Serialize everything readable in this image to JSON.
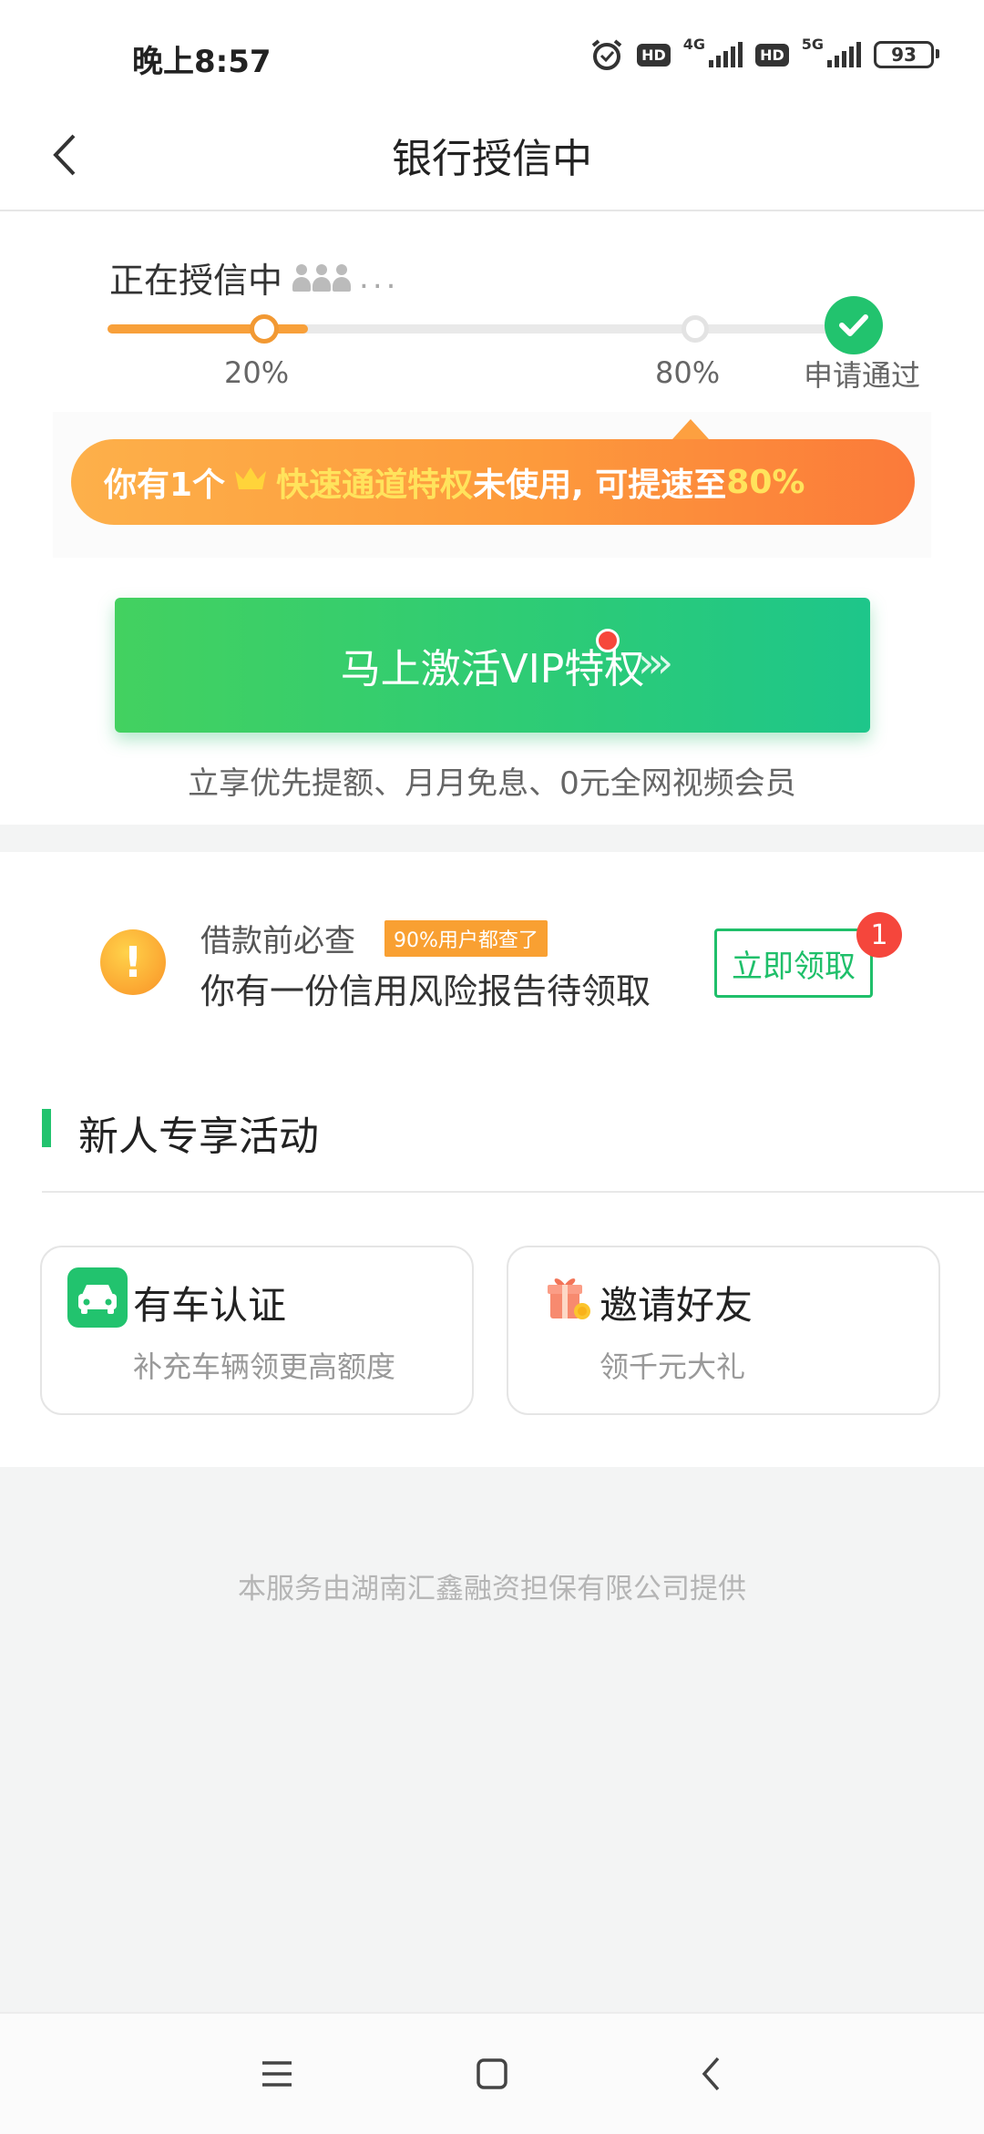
{
  "status_bar": {
    "time": "晚上8:57",
    "icons": [
      "alarm-icon",
      "hd-icon",
      "signal-4g-icon",
      "hd-icon",
      "signal-5g-icon",
      "battery-icon"
    ],
    "hd_label": "HD",
    "net1": "4G",
    "net2": "5G",
    "battery": "93"
  },
  "header": {
    "title": "银行授信中",
    "back_icon": "back-arrow-icon"
  },
  "progress": {
    "status_text": "正在授信中",
    "dots": "...",
    "current_percent": 20,
    "steps": [
      {
        "label": "20%"
      },
      {
        "label": "80%"
      },
      {
        "label": "申请通过"
      }
    ],
    "colors": {
      "fill": "#f8a03a",
      "done": "#22c36e",
      "track": "#e9e9e9"
    }
  },
  "promo": {
    "part1": "你有1个",
    "highlight": "快速通道特权",
    "part2": "未使用, 可提速至",
    "target": "80%",
    "crown_icon": "crown-icon"
  },
  "vip": {
    "button_label": "马上激活VIP特权",
    "arrows": "›››",
    "subtext": "立享优先提额、月月免息、0元全网视频会员"
  },
  "report": {
    "pre_text": "借款前必查",
    "tag": "90%用户都查了",
    "main_text": "你有一份信用风险报告待领取",
    "button_label": "立即领取",
    "badge_count": "1"
  },
  "activities": {
    "title": "新人专享活动",
    "cards": [
      {
        "title": "有车认证",
        "subtitle": "补充车辆领更高额度",
        "icon": "car-icon"
      },
      {
        "title": "邀请好友",
        "subtitle": "领千元大礼",
        "icon": "gift-icon"
      }
    ]
  },
  "footer": {
    "note": "本服务由湖南汇鑫融资担保有限公司提供"
  },
  "system_nav": {
    "buttons": [
      "menu-icon",
      "home-icon",
      "back-icon"
    ]
  }
}
